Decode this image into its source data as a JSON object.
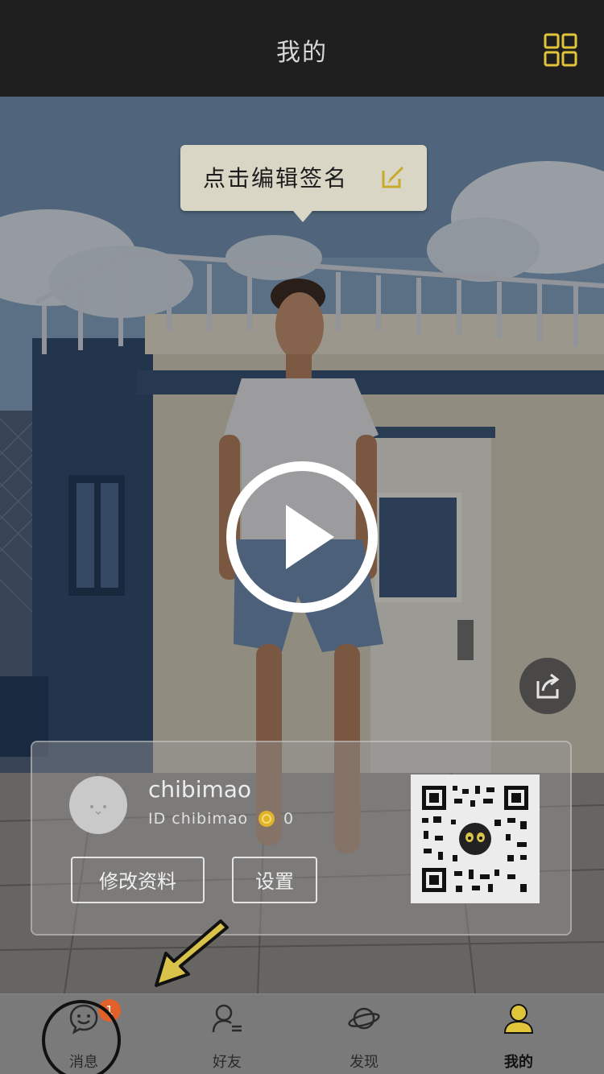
{
  "header": {
    "title": "我的"
  },
  "signature": {
    "text": "点击编辑签名"
  },
  "profile": {
    "username": "chibimao",
    "id_text": "ID  chibimao",
    "coins": "0",
    "edit_profile_label": "修改资料",
    "settings_label": "设置"
  },
  "nav": {
    "messages": {
      "label": "消息",
      "badge": "1"
    },
    "friends": {
      "label": "好友"
    },
    "discover": {
      "label": "发现"
    },
    "me": {
      "label": "我的"
    }
  },
  "colors": {
    "accent": "#e0c43a",
    "badge": "#e2612b",
    "header": "#1f1f1f"
  }
}
